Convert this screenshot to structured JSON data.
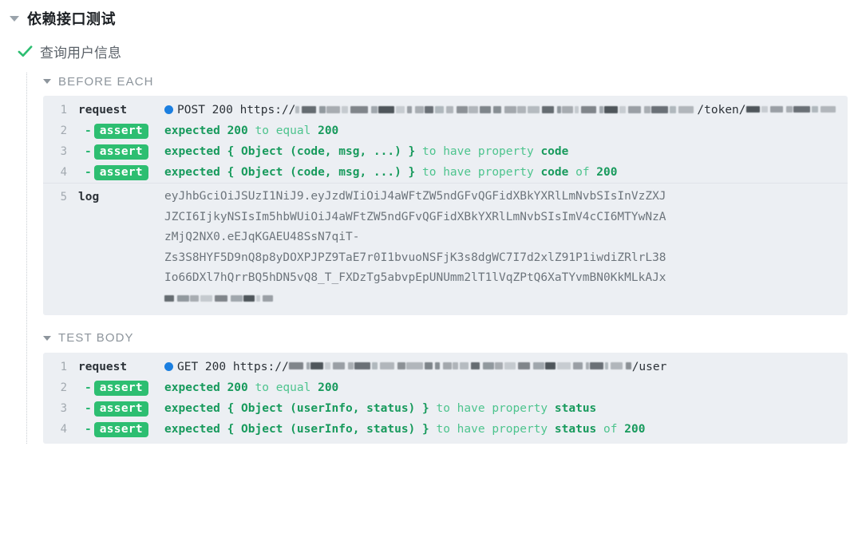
{
  "suite": {
    "title": "依赖接口测试",
    "expanded": true,
    "toggle_icon": "triangle-down-icon"
  },
  "test": {
    "title": "查询用户信息",
    "status": "passed",
    "status_icon": "check-icon",
    "status_color": "#2dbe71"
  },
  "colors": {
    "assert_badge": "#2dbe71",
    "assert_text_bold": "#179a5c",
    "assert_text_light": "#4ec48e",
    "request_dot": "#1b7fe0",
    "table_bg": "#eceff3",
    "line_number": "#a2a9b0"
  },
  "groups": [
    {
      "label": "BEFORE EACH",
      "expanded": true,
      "toggle_icon": "triangle-down-icon",
      "lines": [
        {
          "num": "1",
          "type": "request",
          "label": "request",
          "dot_icon": "status-dot-icon",
          "method": "POST",
          "status": "200",
          "url_prefix": "https://",
          "url_redacted": true,
          "url_suffix": "/token/",
          "url_tail_redacted": true
        },
        {
          "num": "2",
          "type": "assert",
          "label": "assert",
          "dash": "-",
          "parts": [
            {
              "t": "expected",
              "bold": true
            },
            {
              "t": "200",
              "bold": true
            },
            {
              "t": "to equal",
              "bold": false
            },
            {
              "t": "200",
              "bold": true
            }
          ]
        },
        {
          "num": "3",
          "type": "assert",
          "label": "assert",
          "dash": "-",
          "parts": [
            {
              "t": "expected",
              "bold": true
            },
            {
              "t": "{ Object (code, msg, ...) }",
              "bold": true
            },
            {
              "t": "to have property",
              "bold": false
            },
            {
              "t": "code",
              "bold": true
            }
          ]
        },
        {
          "num": "4",
          "type": "assert",
          "label": "assert",
          "dash": "-",
          "parts": [
            {
              "t": "expected",
              "bold": true
            },
            {
              "t": "{ Object (code, msg, ...) }",
              "bold": true
            },
            {
              "t": "to have property",
              "bold": false
            },
            {
              "t": "code",
              "bold": true
            },
            {
              "t": "of",
              "bold": false
            },
            {
              "t": "200",
              "bold": true
            }
          ]
        },
        {
          "num": "5",
          "type": "log",
          "label": "log",
          "text": "eyJhbGciOiJSUzI1NiJ9.eyJzdWIiOiJ4aWFtZW5ndGFvQGFidXBkYXRlLmNvbSIsInVzZXJ\nJZCI6IjkyNSIsIm5hbWUiOiJ4aWFtZW5ndGFvQGFidXBkYXRlLmNvbSIsImV4cCI6MTYwNzA\nzMjQ2NX0.eEJqKGAEU48SsN7qiT-\nZs3S8HYF5D9nQ8p8yDOXPJPZ9TaE7r0I1bvuoNSFjK3s8dgWC7I7d2xlZ91P1iwdiZRlrL38\nIo66DXl7hQrrBQ5hDN5vQ8_T_FXDzTg5abvpEpUNUmm2lT1lVqZPtQ6XaTYvmBN0KkMLkAJx",
          "tail_redacted": true
        }
      ]
    },
    {
      "label": "TEST BODY",
      "expanded": true,
      "toggle_icon": "triangle-down-icon",
      "lines": [
        {
          "num": "1",
          "type": "request",
          "label": "request",
          "dot_icon": "status-dot-icon",
          "method": "GET",
          "status": "200",
          "url_prefix": "https://",
          "url_redacted": true,
          "url_suffix": "/user",
          "url_tail_redacted": false
        },
        {
          "num": "2",
          "type": "assert",
          "label": "assert",
          "dash": "-",
          "parts": [
            {
              "t": "expected",
              "bold": true
            },
            {
              "t": "200",
              "bold": true
            },
            {
              "t": "to equal",
              "bold": false
            },
            {
              "t": "200",
              "bold": true
            }
          ]
        },
        {
          "num": "3",
          "type": "assert",
          "label": "assert",
          "dash": "-",
          "parts": [
            {
              "t": "expected",
              "bold": true
            },
            {
              "t": "{ Object (userInfo, status) }",
              "bold": true
            },
            {
              "t": "to have property",
              "bold": false
            },
            {
              "t": "status",
              "bold": true
            }
          ]
        },
        {
          "num": "4",
          "type": "assert",
          "label": "assert",
          "dash": "-",
          "parts": [
            {
              "t": "expected",
              "bold": true
            },
            {
              "t": "{ Object (userInfo, status) }",
              "bold": true
            },
            {
              "t": "to have property",
              "bold": false
            },
            {
              "t": "status",
              "bold": true
            },
            {
              "t": "of",
              "bold": false
            },
            {
              "t": "200",
              "bold": true
            }
          ]
        }
      ]
    }
  ]
}
